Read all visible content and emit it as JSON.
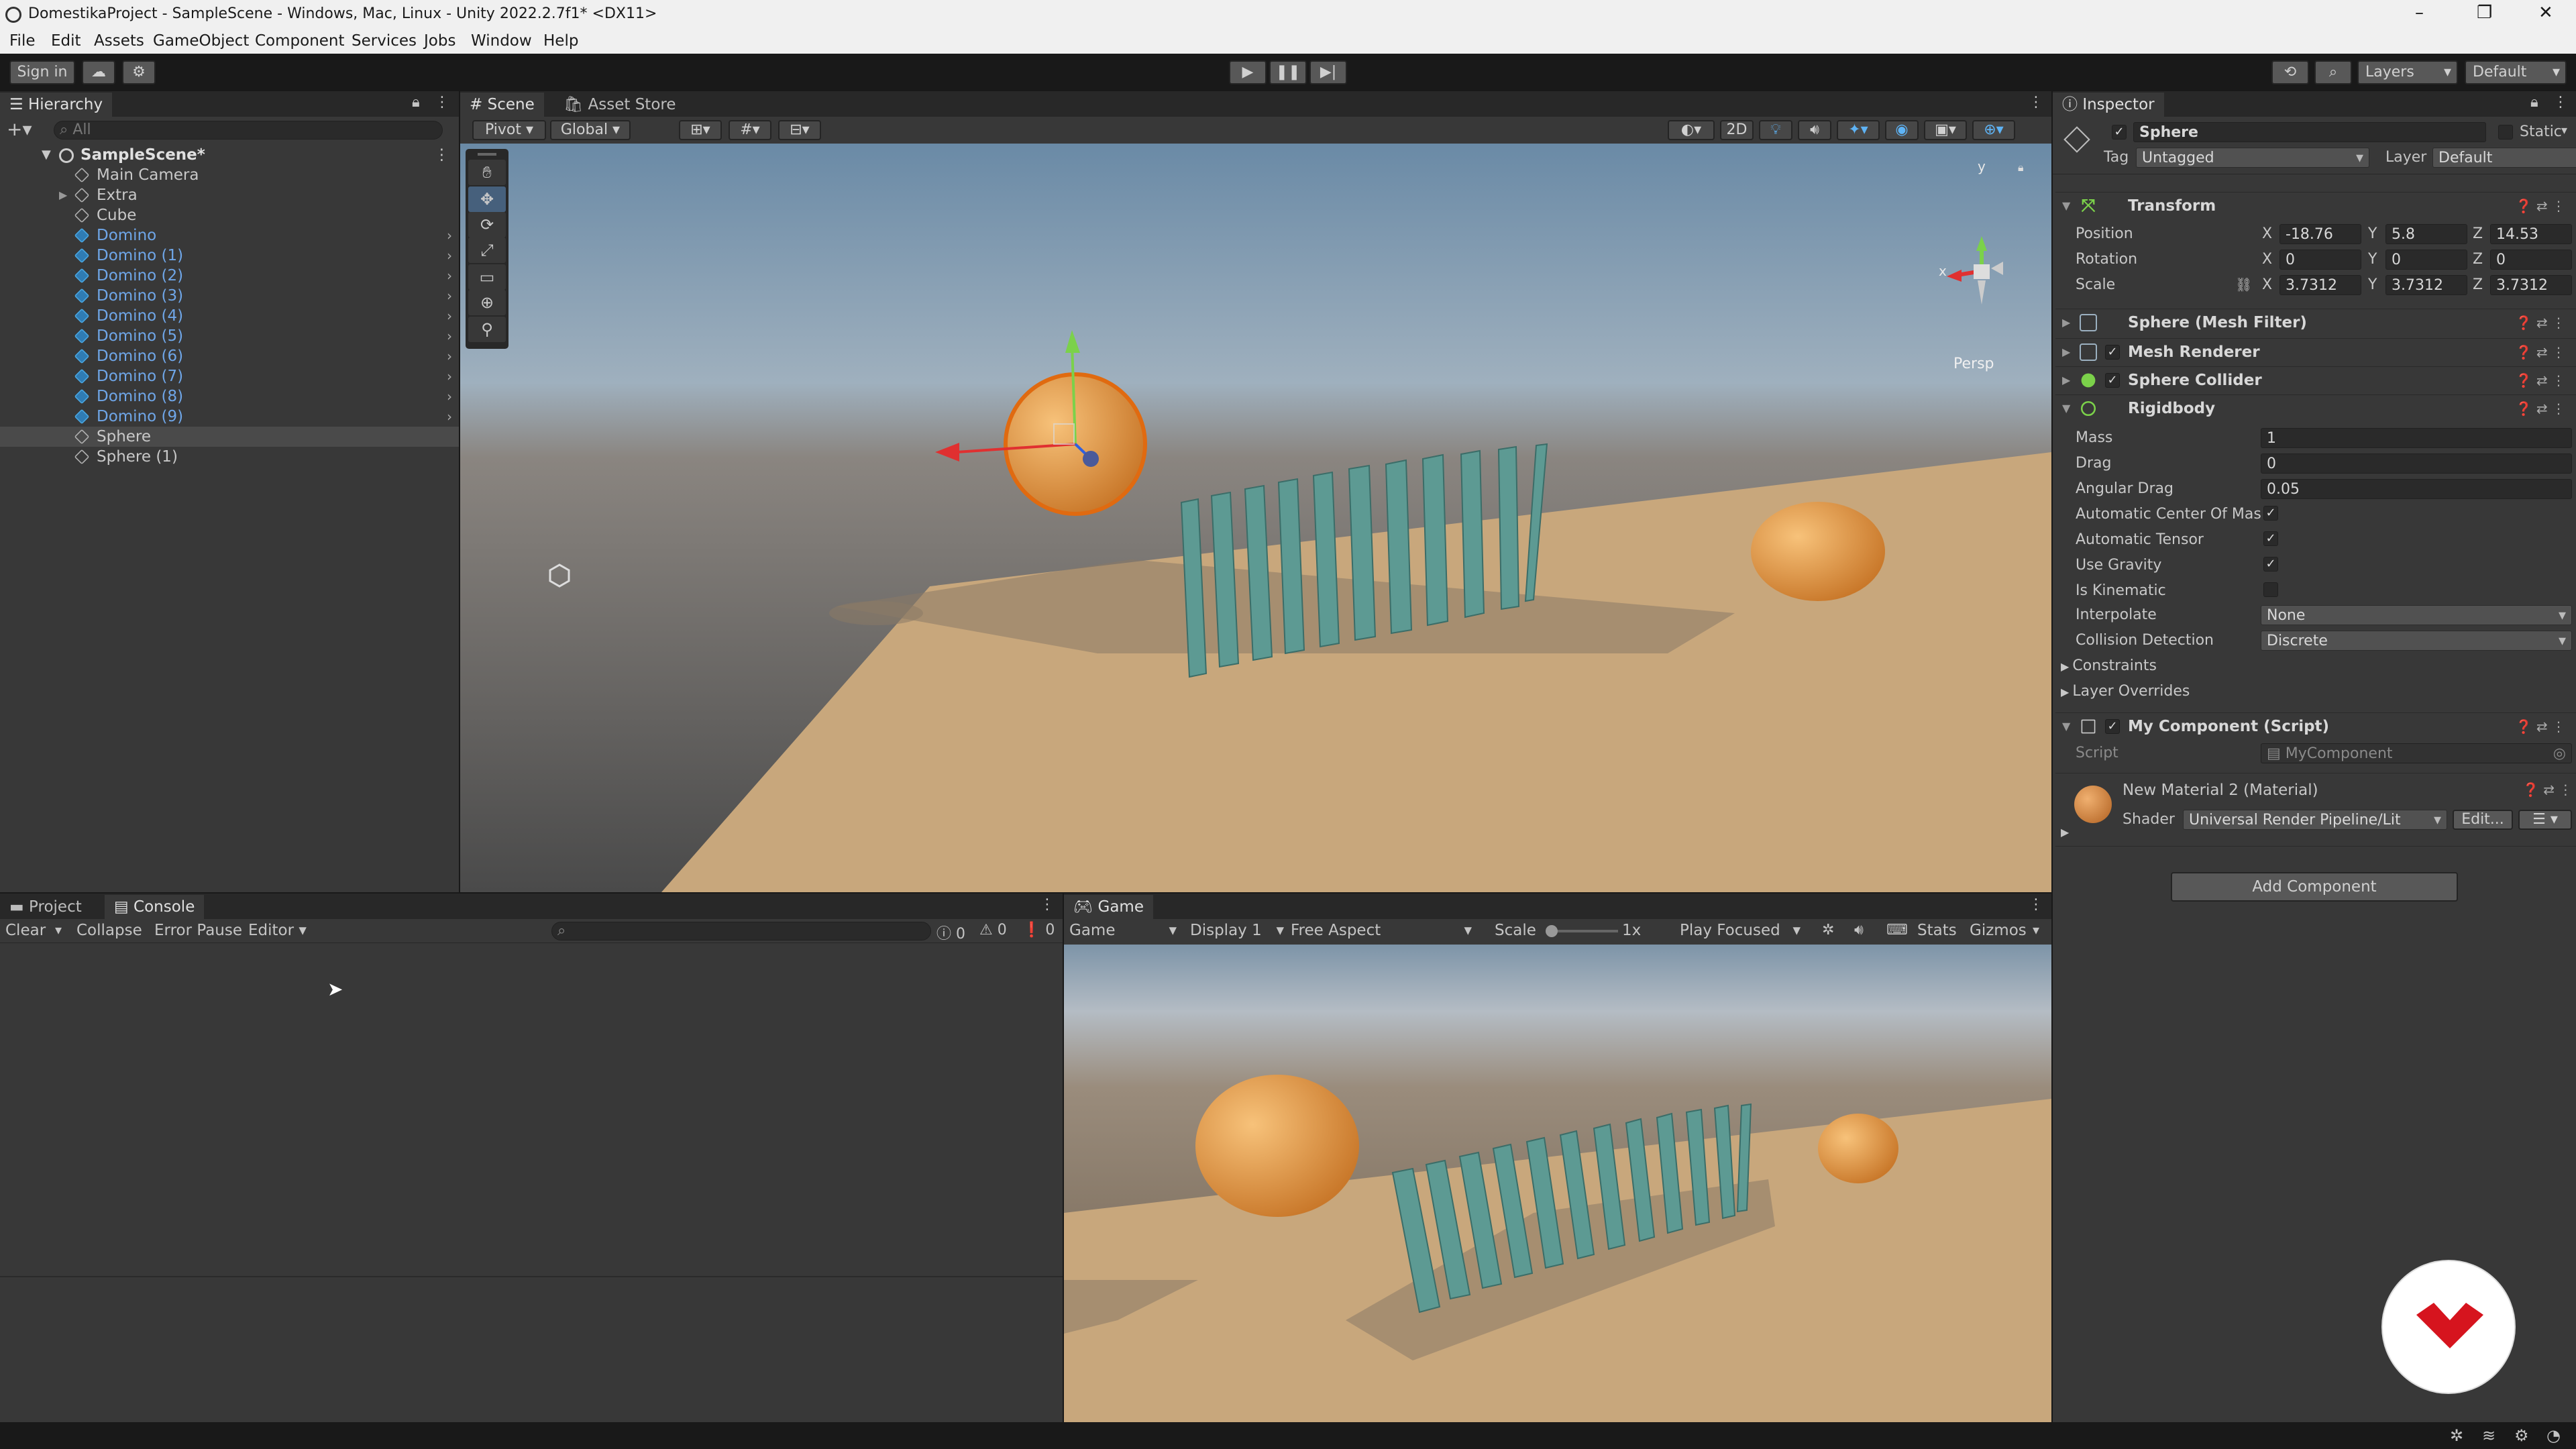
{
  "window": {
    "title": "DomestikaProject - SampleScene - Windows, Mac, Linux - Unity 2022.2.7f1* <DX11>",
    "controls": [
      "–",
      "❐",
      "✕"
    ]
  },
  "menu": [
    "File",
    "Edit",
    "Assets",
    "GameObject",
    "Component",
    "Services",
    "Jobs",
    "Window",
    "Help"
  ],
  "toolbar": {
    "sign_in": "Sign in",
    "layers": "Layers",
    "layout": "Default"
  },
  "hierarchy": {
    "tab": "Hierarchy",
    "search_placeholder": "All",
    "scene": "SampleScene*",
    "items": [
      {
        "label": "Main Camera",
        "prefab": false,
        "indent": 1,
        "expand": false,
        "chevron": false
      },
      {
        "label": "Extra",
        "prefab": false,
        "indent": 1,
        "expand": true,
        "chevron": false
      },
      {
        "label": "Cube",
        "prefab": false,
        "indent": 1,
        "expand": false,
        "chevron": false
      },
      {
        "label": "Domino",
        "prefab": true,
        "indent": 1,
        "expand": false,
        "chevron": true
      },
      {
        "label": "Domino (1)",
        "prefab": true,
        "indent": 1,
        "expand": false,
        "chevron": true
      },
      {
        "label": "Domino (2)",
        "prefab": true,
        "indent": 1,
        "expand": false,
        "chevron": true
      },
      {
        "label": "Domino (3)",
        "prefab": true,
        "indent": 1,
        "expand": false,
        "chevron": true
      },
      {
        "label": "Domino (4)",
        "prefab": true,
        "indent": 1,
        "expand": false,
        "chevron": true
      },
      {
        "label": "Domino (5)",
        "prefab": true,
        "indent": 1,
        "expand": false,
        "chevron": true
      },
      {
        "label": "Domino (6)",
        "prefab": true,
        "indent": 1,
        "expand": false,
        "chevron": true
      },
      {
        "label": "Domino (7)",
        "prefab": true,
        "indent": 1,
        "expand": false,
        "chevron": true
      },
      {
        "label": "Domino (8)",
        "prefab": true,
        "indent": 1,
        "expand": false,
        "chevron": true
      },
      {
        "label": "Domino (9)",
        "prefab": true,
        "indent": 1,
        "expand": false,
        "chevron": true
      },
      {
        "label": "Sphere",
        "prefab": false,
        "indent": 1,
        "expand": false,
        "chevron": false,
        "selected": true
      },
      {
        "label": "Sphere (1)",
        "prefab": false,
        "indent": 1,
        "expand": false,
        "chevron": false
      }
    ]
  },
  "scene": {
    "tabs": [
      "Scene",
      "Asset Store"
    ],
    "pivot": "Pivot",
    "global": "Global",
    "mode_2d": "2D",
    "persp": "Persp",
    "gizmo_y": "y",
    "gizmo_x": "x"
  },
  "bottom": {
    "tabs": [
      "Project",
      "Console"
    ],
    "clear": "Clear",
    "collapse": "Collapse",
    "error_pause": "Error Pause",
    "editor": "Editor",
    "counts": [
      "0",
      "0",
      "0"
    ]
  },
  "game": {
    "tab": "Game",
    "view": "Game",
    "display": "Display 1",
    "aspect": "Free Aspect",
    "scale_label": "Scale",
    "scale_value": "1x",
    "play_mode": "Play Focused",
    "stats": "Stats",
    "gizmos": "Gizmos"
  },
  "inspector": {
    "tab": "Inspector",
    "object_name": "Sphere",
    "static_label": "Static",
    "tag_label": "Tag",
    "tag_value": "Untagged",
    "layer_label": "Layer",
    "layer_value": "Default",
    "transform": {
      "title": "Transform",
      "position": {
        "label": "Position",
        "x": "-18.76",
        "y": "5.8",
        "z": "14.53"
      },
      "rotation": {
        "label": "Rotation",
        "x": "0",
        "y": "0",
        "z": "0"
      },
      "scale": {
        "label": "Scale",
        "x": "3.7312",
        "y": "3.7312",
        "z": "3.7312"
      }
    },
    "mesh_filter": "Sphere (Mesh Filter)",
    "mesh_renderer": "Mesh Renderer",
    "sphere_collider": "Sphere Collider",
    "rigidbody": {
      "title": "Rigidbody",
      "mass_label": "Mass",
      "mass": "1",
      "drag_label": "Drag",
      "drag": "0",
      "angular_label": "Angular Drag",
      "angular": "0.05",
      "auto_com_label": "Automatic Center Of Mass",
      "auto_tensor_label": "Automatic Tensor",
      "gravity_label": "Use Gravity",
      "kinematic_label": "Is Kinematic",
      "interpolate_label": "Interpolate",
      "interpolate": "None",
      "collision_label": "Collision Detection",
      "collision": "Discrete",
      "constraints": "Constraints",
      "layer_overrides": "Layer Overrides"
    },
    "my_component": {
      "title": "My Component (Script)",
      "script_label": "Script",
      "script_value": "MyComponent"
    },
    "material": {
      "title": "New Material 2 (Material)",
      "shader_label": "Shader",
      "shader_value": "Universal Render Pipeline/Lit",
      "edit": "Edit..."
    },
    "add_component": "Add Component"
  },
  "colors": {
    "accent": "#4aa6e0",
    "prefab_text": "#6fa6e8",
    "orange": "#e0923a",
    "brand_red": "#d6141e"
  }
}
